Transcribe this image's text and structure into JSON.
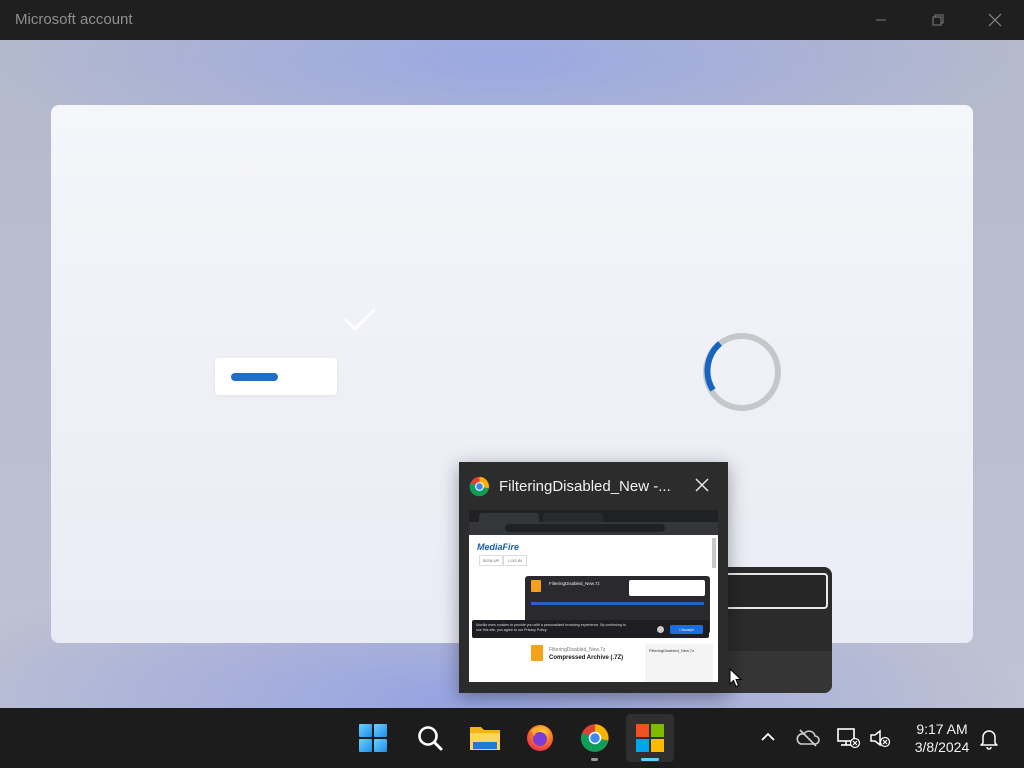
{
  "window": {
    "title": "Microsoft account",
    "controls": [
      "minimize",
      "restore",
      "close"
    ]
  },
  "preview": {
    "title": "FilteringDisabled_New -...",
    "thumbnail": {
      "site_logo": "MediaFire",
      "nav_buttons": [
        "SIGN UP",
        "LOG IN"
      ],
      "download_file": "FilteringDisabled_New.7z",
      "cookie_text": "Mozilla uses cookies to provide you with a personalized browsing experience. By continuing to use this site, you agree to our Privacy Policy.",
      "accept_label": "I Accept",
      "file_name": "FilteringDisabled_New.7z",
      "file_type": "Compressed Archive (.7Z)",
      "side_title": "FilteringDisabled_New.7z"
    }
  },
  "taskbar": {
    "apps": [
      {
        "name": "Start",
        "icon": "windows-start-icon"
      },
      {
        "name": "Search",
        "icon": "search-icon"
      },
      {
        "name": "File Explorer",
        "icon": "file-explorer-icon"
      },
      {
        "name": "Firefox",
        "icon": "firefox-icon"
      },
      {
        "name": "Chrome",
        "icon": "chrome-icon"
      },
      {
        "name": "Microsoft Store",
        "icon": "microsoft-logo-icon"
      }
    ],
    "tray": {
      "time": "9:17 AM",
      "date": "3/8/2024"
    }
  },
  "colors": {
    "accent": "#1f6fc9",
    "spinner": "#1565c0",
    "taskbar": "#1c1c1c"
  }
}
